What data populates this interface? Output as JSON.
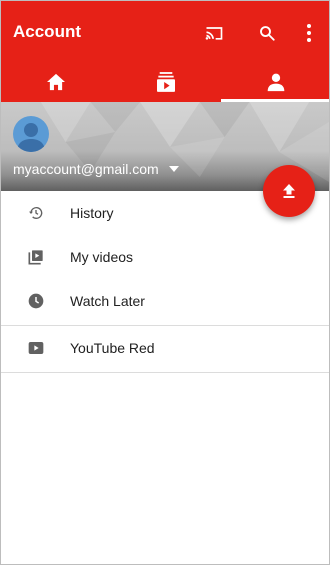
{
  "appbar": {
    "title": "Account",
    "icons": [
      "cast-icon",
      "search-icon",
      "more-vert-icon"
    ],
    "color": "#e62117"
  },
  "tabs": [
    {
      "name": "home",
      "icon": "home-icon",
      "selected": false
    },
    {
      "name": "subscriptions",
      "icon": "subscriptions-icon",
      "selected": false
    },
    {
      "name": "account",
      "icon": "person-icon",
      "selected": true
    }
  ],
  "account": {
    "email": "myaccount@gmail.com",
    "avatar_color": "#5b9bd5"
  },
  "fab": {
    "icon": "upload-icon"
  },
  "menu": {
    "items": [
      {
        "label": "History",
        "icon": "history-icon"
      },
      {
        "label": "My videos",
        "icon": "my-videos-icon"
      },
      {
        "label": "Watch Later",
        "icon": "watch-later-icon"
      }
    ],
    "secondary": [
      {
        "label": "YouTube Red",
        "icon": "youtube-red-icon"
      }
    ]
  }
}
